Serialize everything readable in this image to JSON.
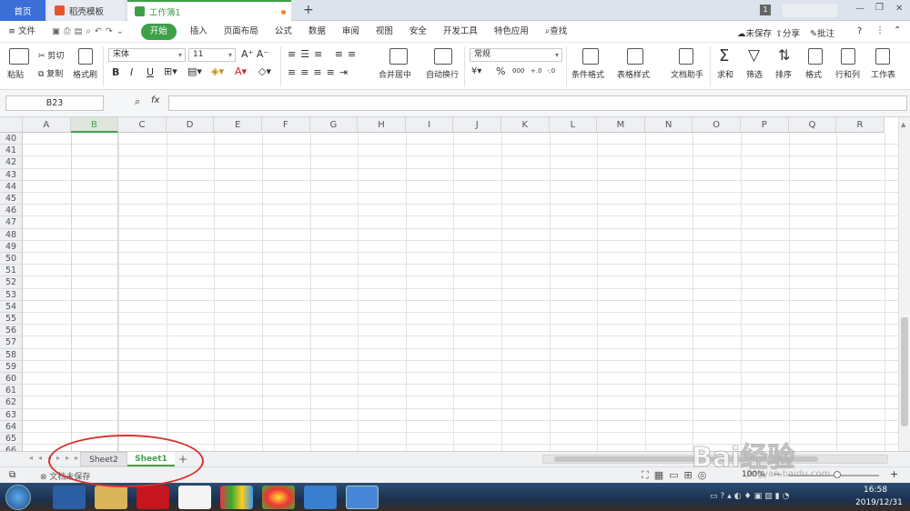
{
  "tabs": {
    "home": "首页",
    "daoke": "稻壳模板",
    "workbook": "工作簿1",
    "new_tab": "+",
    "badge": "1"
  },
  "window": {
    "minimize": "—",
    "restore": "❐",
    "close": "✕"
  },
  "menubar": {
    "file": "文件",
    "items": [
      "开始",
      "插入",
      "页面布局",
      "公式",
      "数据",
      "审阅",
      "视图",
      "安全",
      "开发工具",
      "特色应用"
    ],
    "search": "查找",
    "unsaved": "未保存",
    "share": "分享",
    "comment": "批注",
    "help": "?"
  },
  "ribbon": {
    "paste": "粘贴",
    "cut": "剪切",
    "copy": "复制",
    "format_painter": "格式刷",
    "font_name": "宋体",
    "font_size": "11",
    "bold": "B",
    "italic": "I",
    "underline": "U",
    "merge": "合并居中",
    "wrap": "自动换行",
    "number_format": "常规",
    "percent": "%",
    "thousands": "000",
    "inc_decimal": "+.0",
    "dec_decimal": "-.0",
    "conditional": "条件格式",
    "table_style": "表格样式",
    "doc_assist": "文档助手",
    "sum": "求和",
    "filter": "筛选",
    "sort": "排序",
    "format": "格式",
    "rowcol": "行和列",
    "worksheet": "工作表"
  },
  "formula_bar": {
    "cell_ref": "B23",
    "fx": "fx",
    "zoom_icon": "⌕"
  },
  "columns": [
    "A",
    "B",
    "C",
    "D",
    "E",
    "F",
    "G",
    "H",
    "I",
    "J",
    "K",
    "L",
    "M",
    "N",
    "O",
    "P",
    "Q",
    "R"
  ],
  "selected_column": "B",
  "rows": [
    "40",
    "41",
    "42",
    "43",
    "44",
    "45",
    "46",
    "47",
    "48",
    "49",
    "50",
    "51",
    "52",
    "53",
    "54",
    "55",
    "56",
    "57",
    "58",
    "59",
    "60",
    "61",
    "62",
    "63",
    "64",
    "65",
    "66"
  ],
  "sheets": [
    {
      "name": "Sheet2",
      "active": false
    },
    {
      "name": "Sheet1",
      "active": true
    }
  ],
  "add_sheet": "+",
  "status": {
    "doc_state": "文档未保存",
    "zoom": "100%",
    "minus": "—",
    "plus": "+"
  },
  "taskbar": {
    "time": "16:58",
    "date": "2019/12/31"
  },
  "watermark": {
    "brand": "Bai经验",
    "url": "jingyan.baidu.com"
  },
  "colors": {
    "accent_green": "#3fa04a",
    "home_tab_blue": "#3b6fd6",
    "callout_red": "#d8322c"
  }
}
